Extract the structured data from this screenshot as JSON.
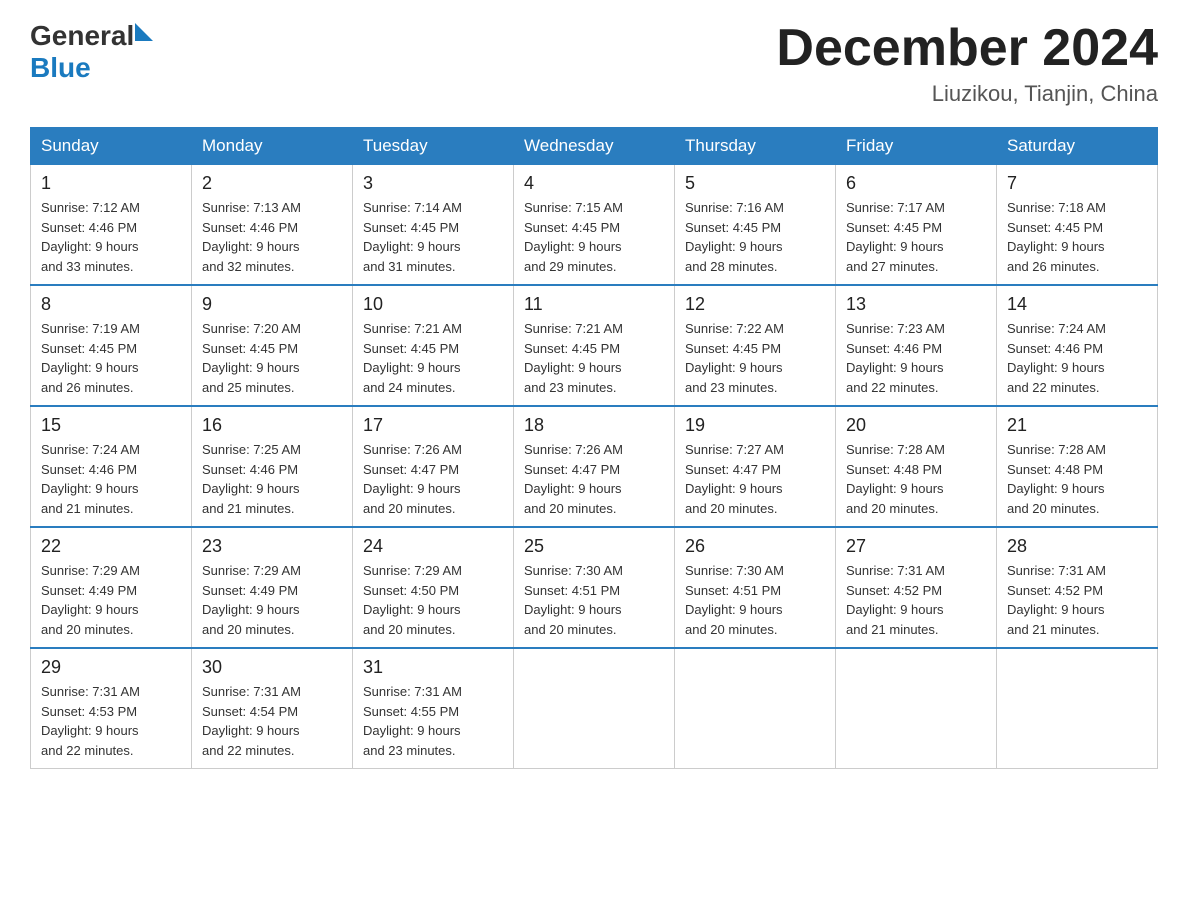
{
  "header": {
    "logo_general": "General",
    "logo_blue": "Blue",
    "title": "December 2024",
    "location": "Liuzikou, Tianjin, China"
  },
  "days_of_week": [
    "Sunday",
    "Monday",
    "Tuesday",
    "Wednesday",
    "Thursday",
    "Friday",
    "Saturday"
  ],
  "weeks": [
    [
      {
        "day": "1",
        "sunrise": "7:12 AM",
        "sunset": "4:46 PM",
        "daylight": "9 hours and 33 minutes."
      },
      {
        "day": "2",
        "sunrise": "7:13 AM",
        "sunset": "4:46 PM",
        "daylight": "9 hours and 32 minutes."
      },
      {
        "day": "3",
        "sunrise": "7:14 AM",
        "sunset": "4:45 PM",
        "daylight": "9 hours and 31 minutes."
      },
      {
        "day": "4",
        "sunrise": "7:15 AM",
        "sunset": "4:45 PM",
        "daylight": "9 hours and 29 minutes."
      },
      {
        "day": "5",
        "sunrise": "7:16 AM",
        "sunset": "4:45 PM",
        "daylight": "9 hours and 28 minutes."
      },
      {
        "day": "6",
        "sunrise": "7:17 AM",
        "sunset": "4:45 PM",
        "daylight": "9 hours and 27 minutes."
      },
      {
        "day": "7",
        "sunrise": "7:18 AM",
        "sunset": "4:45 PM",
        "daylight": "9 hours and 26 minutes."
      }
    ],
    [
      {
        "day": "8",
        "sunrise": "7:19 AM",
        "sunset": "4:45 PM",
        "daylight": "9 hours and 26 minutes."
      },
      {
        "day": "9",
        "sunrise": "7:20 AM",
        "sunset": "4:45 PM",
        "daylight": "9 hours and 25 minutes."
      },
      {
        "day": "10",
        "sunrise": "7:21 AM",
        "sunset": "4:45 PM",
        "daylight": "9 hours and 24 minutes."
      },
      {
        "day": "11",
        "sunrise": "7:21 AM",
        "sunset": "4:45 PM",
        "daylight": "9 hours and 23 minutes."
      },
      {
        "day": "12",
        "sunrise": "7:22 AM",
        "sunset": "4:45 PM",
        "daylight": "9 hours and 23 minutes."
      },
      {
        "day": "13",
        "sunrise": "7:23 AM",
        "sunset": "4:46 PM",
        "daylight": "9 hours and 22 minutes."
      },
      {
        "day": "14",
        "sunrise": "7:24 AM",
        "sunset": "4:46 PM",
        "daylight": "9 hours and 22 minutes."
      }
    ],
    [
      {
        "day": "15",
        "sunrise": "7:24 AM",
        "sunset": "4:46 PM",
        "daylight": "9 hours and 21 minutes."
      },
      {
        "day": "16",
        "sunrise": "7:25 AM",
        "sunset": "4:46 PM",
        "daylight": "9 hours and 21 minutes."
      },
      {
        "day": "17",
        "sunrise": "7:26 AM",
        "sunset": "4:47 PM",
        "daylight": "9 hours and 20 minutes."
      },
      {
        "day": "18",
        "sunrise": "7:26 AM",
        "sunset": "4:47 PM",
        "daylight": "9 hours and 20 minutes."
      },
      {
        "day": "19",
        "sunrise": "7:27 AM",
        "sunset": "4:47 PM",
        "daylight": "9 hours and 20 minutes."
      },
      {
        "day": "20",
        "sunrise": "7:28 AM",
        "sunset": "4:48 PM",
        "daylight": "9 hours and 20 minutes."
      },
      {
        "day": "21",
        "sunrise": "7:28 AM",
        "sunset": "4:48 PM",
        "daylight": "9 hours and 20 minutes."
      }
    ],
    [
      {
        "day": "22",
        "sunrise": "7:29 AM",
        "sunset": "4:49 PM",
        "daylight": "9 hours and 20 minutes."
      },
      {
        "day": "23",
        "sunrise": "7:29 AM",
        "sunset": "4:49 PM",
        "daylight": "9 hours and 20 minutes."
      },
      {
        "day": "24",
        "sunrise": "7:29 AM",
        "sunset": "4:50 PM",
        "daylight": "9 hours and 20 minutes."
      },
      {
        "day": "25",
        "sunrise": "7:30 AM",
        "sunset": "4:51 PM",
        "daylight": "9 hours and 20 minutes."
      },
      {
        "day": "26",
        "sunrise": "7:30 AM",
        "sunset": "4:51 PM",
        "daylight": "9 hours and 20 minutes."
      },
      {
        "day": "27",
        "sunrise": "7:31 AM",
        "sunset": "4:52 PM",
        "daylight": "9 hours and 21 minutes."
      },
      {
        "day": "28",
        "sunrise": "7:31 AM",
        "sunset": "4:52 PM",
        "daylight": "9 hours and 21 minutes."
      }
    ],
    [
      {
        "day": "29",
        "sunrise": "7:31 AM",
        "sunset": "4:53 PM",
        "daylight": "9 hours and 22 minutes."
      },
      {
        "day": "30",
        "sunrise": "7:31 AM",
        "sunset": "4:54 PM",
        "daylight": "9 hours and 22 minutes."
      },
      {
        "day": "31",
        "sunrise": "7:31 AM",
        "sunset": "4:55 PM",
        "daylight": "9 hours and 23 minutes."
      },
      null,
      null,
      null,
      null
    ]
  ],
  "labels": {
    "sunrise": "Sunrise:",
    "sunset": "Sunset:",
    "daylight": "Daylight:"
  }
}
